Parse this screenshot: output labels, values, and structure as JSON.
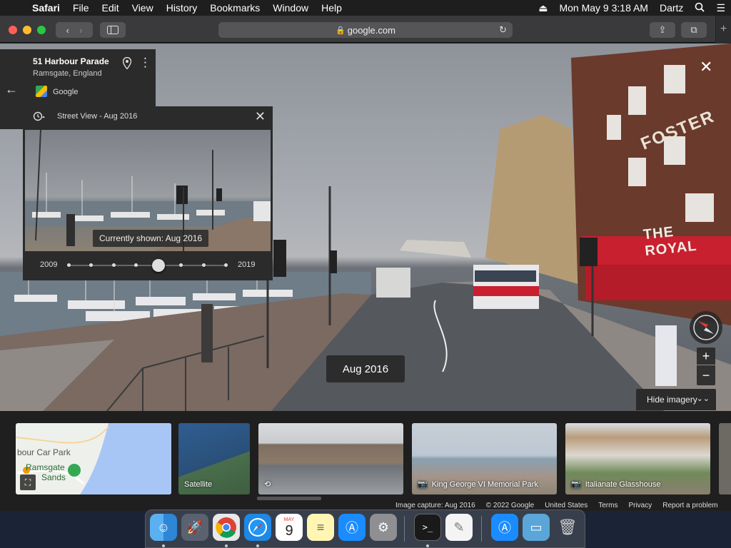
{
  "menubar": {
    "app": "Safari",
    "items": [
      "File",
      "Edit",
      "View",
      "History",
      "Bookmarks",
      "Window",
      "Help"
    ],
    "datetime": "Mon May 9  3:18 AM",
    "user": "Dartz"
  },
  "browser": {
    "url": "google.com"
  },
  "address_card": {
    "title": "51 Harbour Parade",
    "subtitle": "Ramsgate, England",
    "provider": "Google"
  },
  "time_travel": {
    "header": "Street View - Aug 2016",
    "caption": "Currently shown: Aug 2016",
    "year_start": "2009",
    "year_end": "2019",
    "selected_index": 4,
    "stop_count": 8
  },
  "scene": {
    "date_label": "Aug 2016",
    "hide_imagery_label": "Hide imagery",
    "building_sign": "THE ROYAL",
    "building_sign_2": "FOSTER"
  },
  "filmstrip": {
    "map_labels": [
      "bour Car Park",
      "Ramsgate",
      "Sands"
    ],
    "tiles": [
      {
        "label": "Satellite"
      },
      {
        "label": ""
      },
      {
        "label": "King George VI Memorial Park"
      },
      {
        "label": "Italianate Glasshouse"
      }
    ]
  },
  "footer": {
    "items": [
      "Image capture: Aug 2016",
      "© 2022 Google",
      "United States",
      "Terms",
      "Privacy",
      "Report a problem"
    ]
  },
  "colors": {
    "menubar_bg": "#1e1e1e",
    "toolbar_bg": "#3a3a3c",
    "panel_bg": "#2b2b2b",
    "filmstrip_bg": "#1f1f1f",
    "pub_red": "#c8202e"
  }
}
